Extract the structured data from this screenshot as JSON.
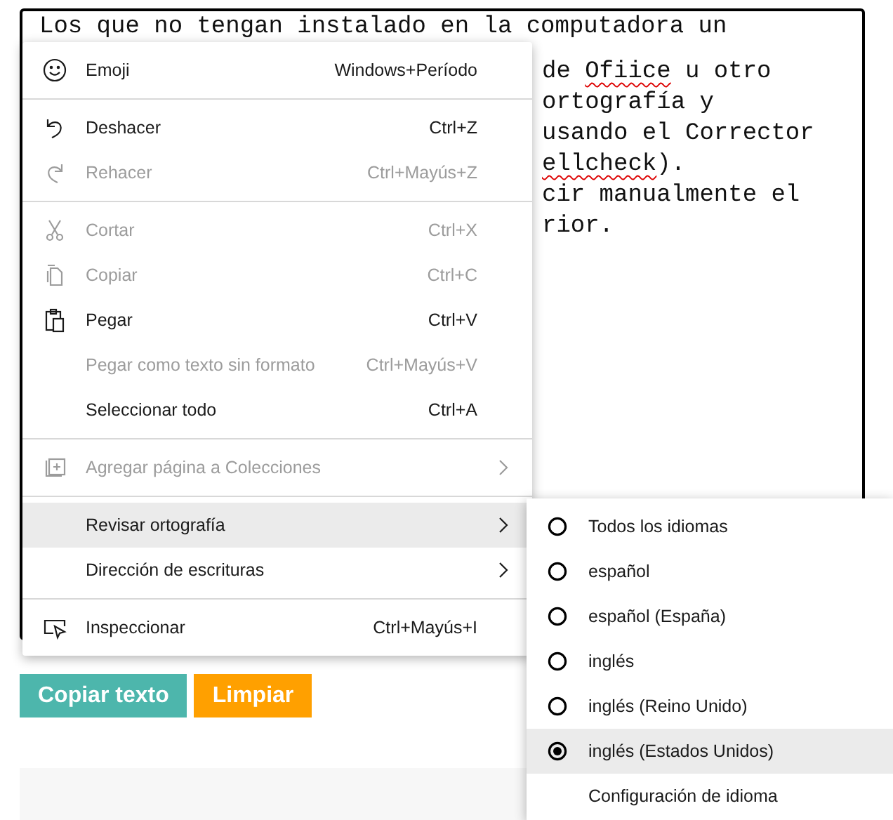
{
  "editor": {
    "first_line": "Los que no tengan instalado en la computadora un",
    "visible_fragments": [
      [
        {
          "text": "de "
        },
        {
          "text": "Ofiice",
          "misspelled": true
        },
        {
          "text": " u otro"
        }
      ],
      [
        {
          "text": "ortografía y"
        }
      ],
      [
        {
          "text": "usando el Corrector"
        }
      ],
      [
        {
          "text": "ellcheck",
          "misspelled": true
        },
        {
          "text": ")."
        }
      ],
      [
        {
          "text": "cir manualmente el"
        }
      ],
      [
        {
          "text": "rior."
        }
      ]
    ]
  },
  "context_menu": {
    "groups": [
      [
        {
          "kind": "emoji",
          "label": "Emoji",
          "shortcut": "Windows+Período",
          "disabled": false,
          "submenu": false,
          "expanded": false
        }
      ],
      [
        {
          "kind": "undo",
          "label": "Deshacer",
          "shortcut": "Ctrl+Z",
          "disabled": false,
          "submenu": false,
          "expanded": false
        },
        {
          "kind": "redo",
          "label": "Rehacer",
          "shortcut": "Ctrl+Mayús+Z",
          "disabled": true,
          "submenu": false,
          "expanded": false
        }
      ],
      [
        {
          "kind": "cut",
          "label": "Cortar",
          "shortcut": "Ctrl+X",
          "disabled": true,
          "submenu": false,
          "expanded": false
        },
        {
          "kind": "copy",
          "label": "Copiar",
          "shortcut": "Ctrl+C",
          "disabled": true,
          "submenu": false,
          "expanded": false
        },
        {
          "kind": "paste",
          "label": "Pegar",
          "shortcut": "Ctrl+V",
          "disabled": false,
          "submenu": false,
          "expanded": false
        },
        {
          "kind": "plain",
          "label": "Pegar como texto sin formato",
          "shortcut": "Ctrl+Mayús+V",
          "disabled": true,
          "submenu": false,
          "expanded": false
        },
        {
          "kind": "plain",
          "label": "Seleccionar todo",
          "shortcut": "Ctrl+A",
          "disabled": false,
          "submenu": false,
          "expanded": false
        }
      ],
      [
        {
          "kind": "collections",
          "label": "Agregar página a Colecciones",
          "disabled": true,
          "submenu": true,
          "expanded": false
        }
      ],
      [
        {
          "kind": "plain",
          "label": "Revisar ortografía",
          "disabled": false,
          "submenu": true,
          "expanded": true
        },
        {
          "kind": "plain",
          "label": "Dirección de escrituras",
          "disabled": false,
          "submenu": true,
          "expanded": false
        }
      ],
      [
        {
          "kind": "inspect",
          "label": "Inspeccionar",
          "shortcut": "Ctrl+Mayús+I",
          "disabled": false,
          "submenu": false,
          "expanded": false
        }
      ]
    ]
  },
  "language_submenu": {
    "items": [
      {
        "kind": "radio",
        "label": "Todos los idiomas",
        "selected": false
      },
      {
        "kind": "radio",
        "label": "español",
        "selected": false
      },
      {
        "kind": "radio",
        "label": "español (España)",
        "selected": false
      },
      {
        "kind": "radio",
        "label": "inglés",
        "selected": false
      },
      {
        "kind": "radio",
        "label": "inglés (Reino Unido)",
        "selected": false
      },
      {
        "kind": "radio",
        "label": "inglés (Estados Unidos)",
        "selected": true
      },
      {
        "kind": "link",
        "label": "Configuración de idioma"
      }
    ]
  },
  "buttons": [
    {
      "kind": "copy",
      "label": "Copiar texto"
    },
    {
      "kind": "clear",
      "label": "Limpiar"
    }
  ]
}
